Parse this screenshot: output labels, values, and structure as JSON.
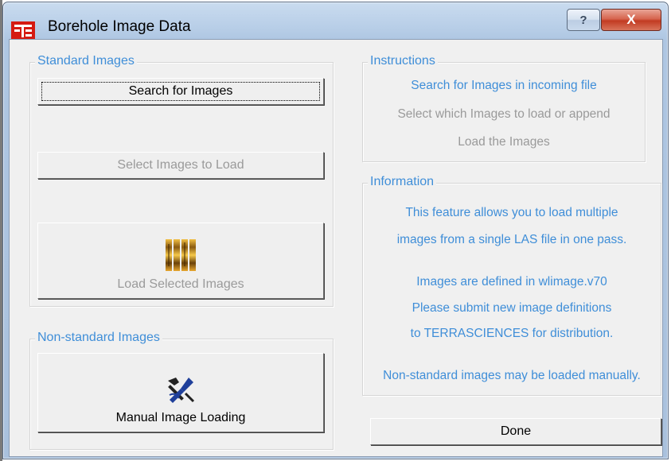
{
  "window": {
    "title": "Borehole Image Data",
    "help_label": "?",
    "close_label": "X"
  },
  "standard_images": {
    "legend": "Standard Images",
    "search_label": "Search for Images",
    "select_label": "Select Images to Load",
    "load_label": "Load Selected Images"
  },
  "non_standard_images": {
    "legend": "Non-standard Images",
    "manual_label": "Manual Image Loading"
  },
  "instructions": {
    "legend": "Instructions",
    "steps": [
      "Search for Images in incoming file",
      "Select which Images to load or append",
      "Load the Images"
    ]
  },
  "information": {
    "legend": "Information",
    "lines": [
      "This feature allows you to load multiple",
      "images from a single LAS file in one pass.",
      "Images are defined in wlimage.v70",
      "Please submit new image definitions",
      "to TERRASCIENCES for distribution.",
      "Non-standard images may be loaded manually."
    ]
  },
  "done_label": "Done",
  "icons": {
    "app": "terrasciences-logo-icon",
    "load": "image-strips-icon",
    "manual": "tools-wrench-icon"
  },
  "colors": {
    "accent_text": "#3f8ed8",
    "disabled_text": "#9a9a9a",
    "close_button": "#c23b22"
  }
}
